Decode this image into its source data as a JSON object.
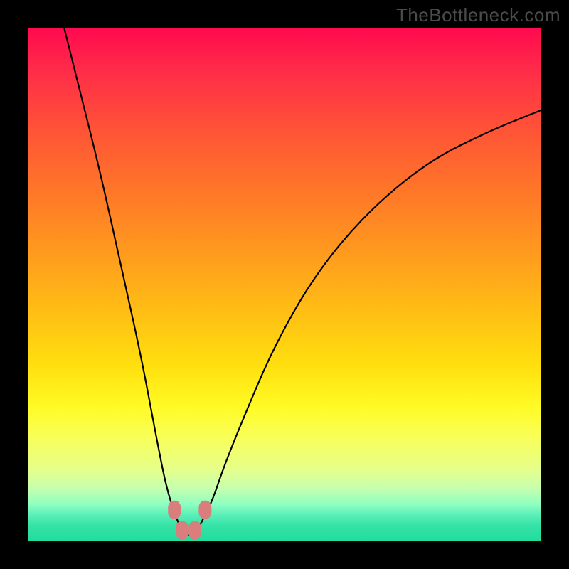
{
  "watermark": "TheBottleneck.com",
  "chart_data": {
    "type": "line",
    "title": "",
    "xlabel": "",
    "ylabel": "",
    "xlim": [
      0,
      100
    ],
    "ylim": [
      0,
      100
    ],
    "background": "vertical heatmap gradient (red at top → green at bottom) indicating bottleneck severity by y-value",
    "series": [
      {
        "name": "bottleneck-curve",
        "color": "#000000",
        "x": [
          7,
          10,
          14,
          18,
          22,
          25,
          27,
          29,
          30,
          31,
          32,
          33,
          34,
          36,
          38,
          42,
          48,
          56,
          66,
          78,
          90,
          100
        ],
        "y": [
          100,
          88,
          72,
          54,
          36,
          20,
          10,
          4,
          2,
          1,
          1,
          2,
          4,
          8,
          14,
          24,
          38,
          52,
          64,
          74,
          80,
          84
        ]
      }
    ],
    "markers": [
      {
        "name": "marker-1",
        "x": 28.5,
        "y": 6,
        "shape": "rounded-rect",
        "color": "#d97d7d"
      },
      {
        "name": "marker-2",
        "x": 30.0,
        "y": 2,
        "shape": "rounded-rect",
        "color": "#d97d7d"
      },
      {
        "name": "marker-3",
        "x": 32.5,
        "y": 2,
        "shape": "rounded-rect",
        "color": "#d97d7d"
      },
      {
        "name": "marker-4",
        "x": 34.5,
        "y": 6,
        "shape": "rounded-rect",
        "color": "#d97d7d"
      }
    ]
  }
}
